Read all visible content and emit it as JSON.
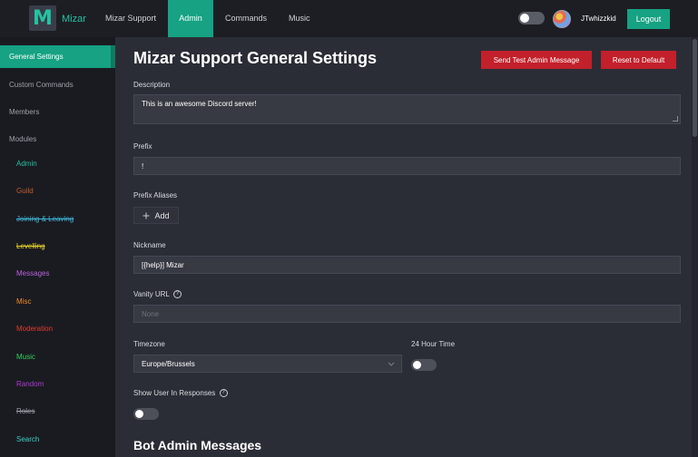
{
  "nav": {
    "logo_letter": "M",
    "brand": "Mizar",
    "items": [
      "Mizar Support",
      "Admin",
      "Commands",
      "Music"
    ],
    "username": "JTwhizzkid",
    "logout": "Logout"
  },
  "sidebar": {
    "items": [
      "General Settings",
      "Custom Commands",
      "Members",
      "Modules"
    ],
    "modules": [
      {
        "label": "Admin",
        "color": "#23c3a1"
      },
      {
        "label": "Guild",
        "color": "#c45a2c"
      },
      {
        "label": "Joining & Leaving",
        "color": "#3fb6d8"
      },
      {
        "label": "Levelling",
        "color": "#e8d52a"
      },
      {
        "label": "Messages",
        "color": "#b763e0"
      },
      {
        "label": "Misc",
        "color": "#f08a24"
      },
      {
        "label": "Moderation",
        "color": "#e23b2f"
      },
      {
        "label": "Music",
        "color": "#33d05d"
      },
      {
        "label": "Random",
        "color": "#b03ad6"
      },
      {
        "label": "Roles",
        "color": "#9da0a8"
      },
      {
        "label": "Search",
        "color": "#3ccfc4"
      }
    ]
  },
  "main": {
    "title": "Mizar Support General Settings",
    "send_test": "Send Test Admin Message",
    "reset": "Reset to Default",
    "description_label": "Description",
    "description_value": "This is an awesome Discord server!",
    "prefix_label": "Prefix",
    "prefix_value": "!",
    "aliases_label": "Prefix Aliases",
    "add_label": "Add",
    "nickname_label": "Nickname",
    "nickname_value": "[{help}] Mizar",
    "vanity_label": "Vanity URL",
    "vanity_placeholder": "None",
    "timezone_label": "Timezone",
    "timezone_value": "Europe/Brussels",
    "hour24_label": "24 Hour Time",
    "show_user_label": "Show User In Responses",
    "bot_admin_title": "Bot Admin Messages"
  }
}
